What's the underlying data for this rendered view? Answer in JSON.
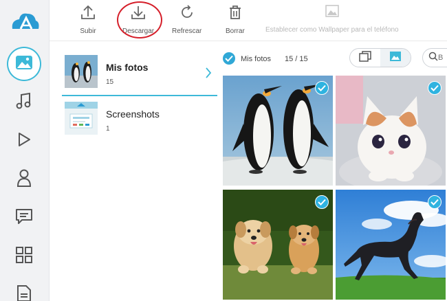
{
  "toolbar": {
    "upload_label": "Subir",
    "download_label": "Descargar",
    "refresh_label": "Refrescar",
    "delete_label": "Borrar",
    "wallpaper_label": "Establecer como Wallpaper para el teléfono"
  },
  "albums": [
    {
      "name": "Mis fotos",
      "count": "15",
      "selected": true
    },
    {
      "name": "Screenshots",
      "count": "1",
      "selected": false
    }
  ],
  "grid_header": {
    "title": "Mis fotos",
    "count": "15 / 15",
    "search_placeholder": "B"
  },
  "colors": {
    "accent": "#3db9d8",
    "check": "#2fb3e0",
    "highlight": "#d51f2a"
  },
  "icons": {
    "sidebar": [
      "photos-icon",
      "music-icon",
      "video-icon",
      "contacts-icon",
      "messages-icon",
      "apps-icon",
      "files-icon"
    ],
    "toolbar": [
      "upload-icon",
      "download-icon",
      "refresh-icon",
      "delete-icon",
      "wallpaper-icon"
    ]
  }
}
